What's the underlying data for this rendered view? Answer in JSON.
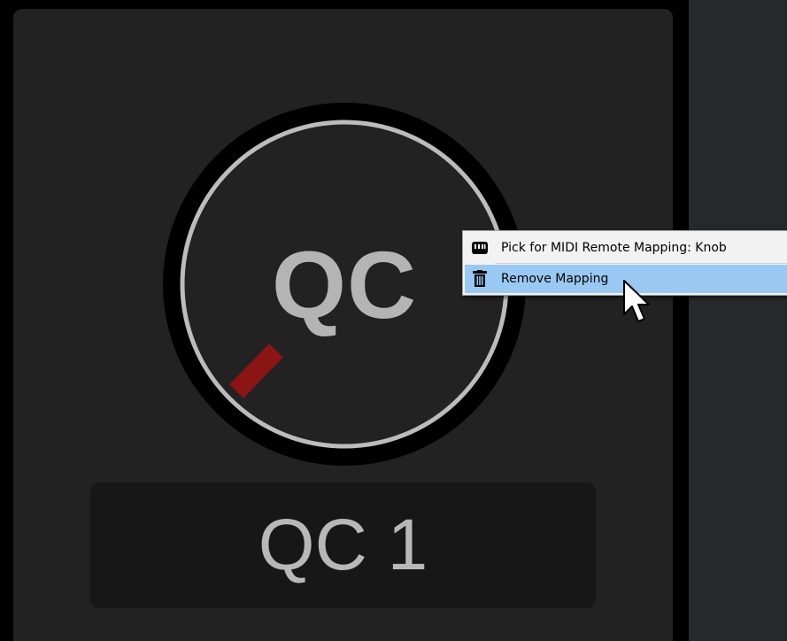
{
  "knob": {
    "label": "QC",
    "value_fraction": 0.0,
    "indicator_color": "#8b1414",
    "ring_color": "#bcbcbc"
  },
  "name_box": {
    "text": "QC 1"
  },
  "context_menu": {
    "items": [
      {
        "label": "Pick for MIDI Remote Mapping: Knob",
        "icon": "midi-keyboard-icon"
      },
      {
        "label": "Remove Mapping",
        "icon": "trash-icon",
        "highlighted": true
      }
    ],
    "highlight_color": "#99c9f2"
  }
}
